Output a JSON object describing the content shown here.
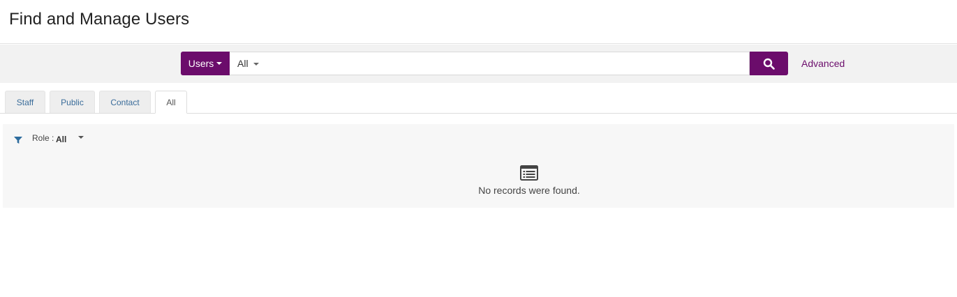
{
  "page": {
    "title": "Find and Manage Users"
  },
  "search": {
    "scope_label": "Users",
    "field_label": "All",
    "query": "",
    "placeholder": "",
    "advanced_label": "Advanced"
  },
  "tabs": [
    {
      "label": "Staff",
      "active": false
    },
    {
      "label": "Public",
      "active": false
    },
    {
      "label": "Contact",
      "active": false
    },
    {
      "label": "All",
      "active": true
    }
  ],
  "filter": {
    "role_label": "Role :",
    "role_value": "All"
  },
  "results": {
    "empty_message": "No records were found."
  },
  "colors": {
    "accent": "#6b0c6b",
    "tab_link": "#3a6c9a",
    "panel_bg": "#f7f7f7",
    "band_bg": "#f2f2f2",
    "filter_icon": "#2d6c9e"
  },
  "icons": {
    "search": "search-icon",
    "filter": "filter-icon",
    "empty": "list-icon"
  }
}
